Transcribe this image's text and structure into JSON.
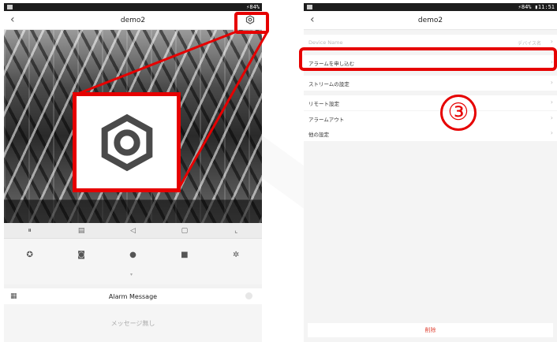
{
  "left_screen": {
    "status_right": "⚡84%",
    "nav": {
      "title": "demo2"
    },
    "alarm": {
      "title": "Alarm Message"
    },
    "no_messages": "メッセージ無し"
  },
  "right_screen": {
    "status_right": "⚡84% ▮11:51",
    "nav": {
      "title": "demo2"
    },
    "rows": [
      {
        "label": "Device Name",
        "value": "デバイス名"
      },
      {
        "label": "アラームを申し込む"
      },
      {
        "label": "ストリームの設定"
      },
      {
        "label": "リモート設定"
      },
      {
        "label": "アラームアウト"
      },
      {
        "label": "他の設定"
      }
    ],
    "delete_label": "削除",
    "step_marker": "③"
  },
  "colors": {
    "highlight": "#e60000",
    "delete": "#e0483a"
  },
  "icons": [
    "back-icon",
    "gear-icon",
    "pause-icon",
    "hd-icon",
    "volume-icon",
    "snapshot-icon",
    "fullscreen-icon",
    "ptz-icon",
    "camera-icon",
    "mic-icon",
    "record-icon",
    "settings-icon",
    "calendar-icon"
  ]
}
